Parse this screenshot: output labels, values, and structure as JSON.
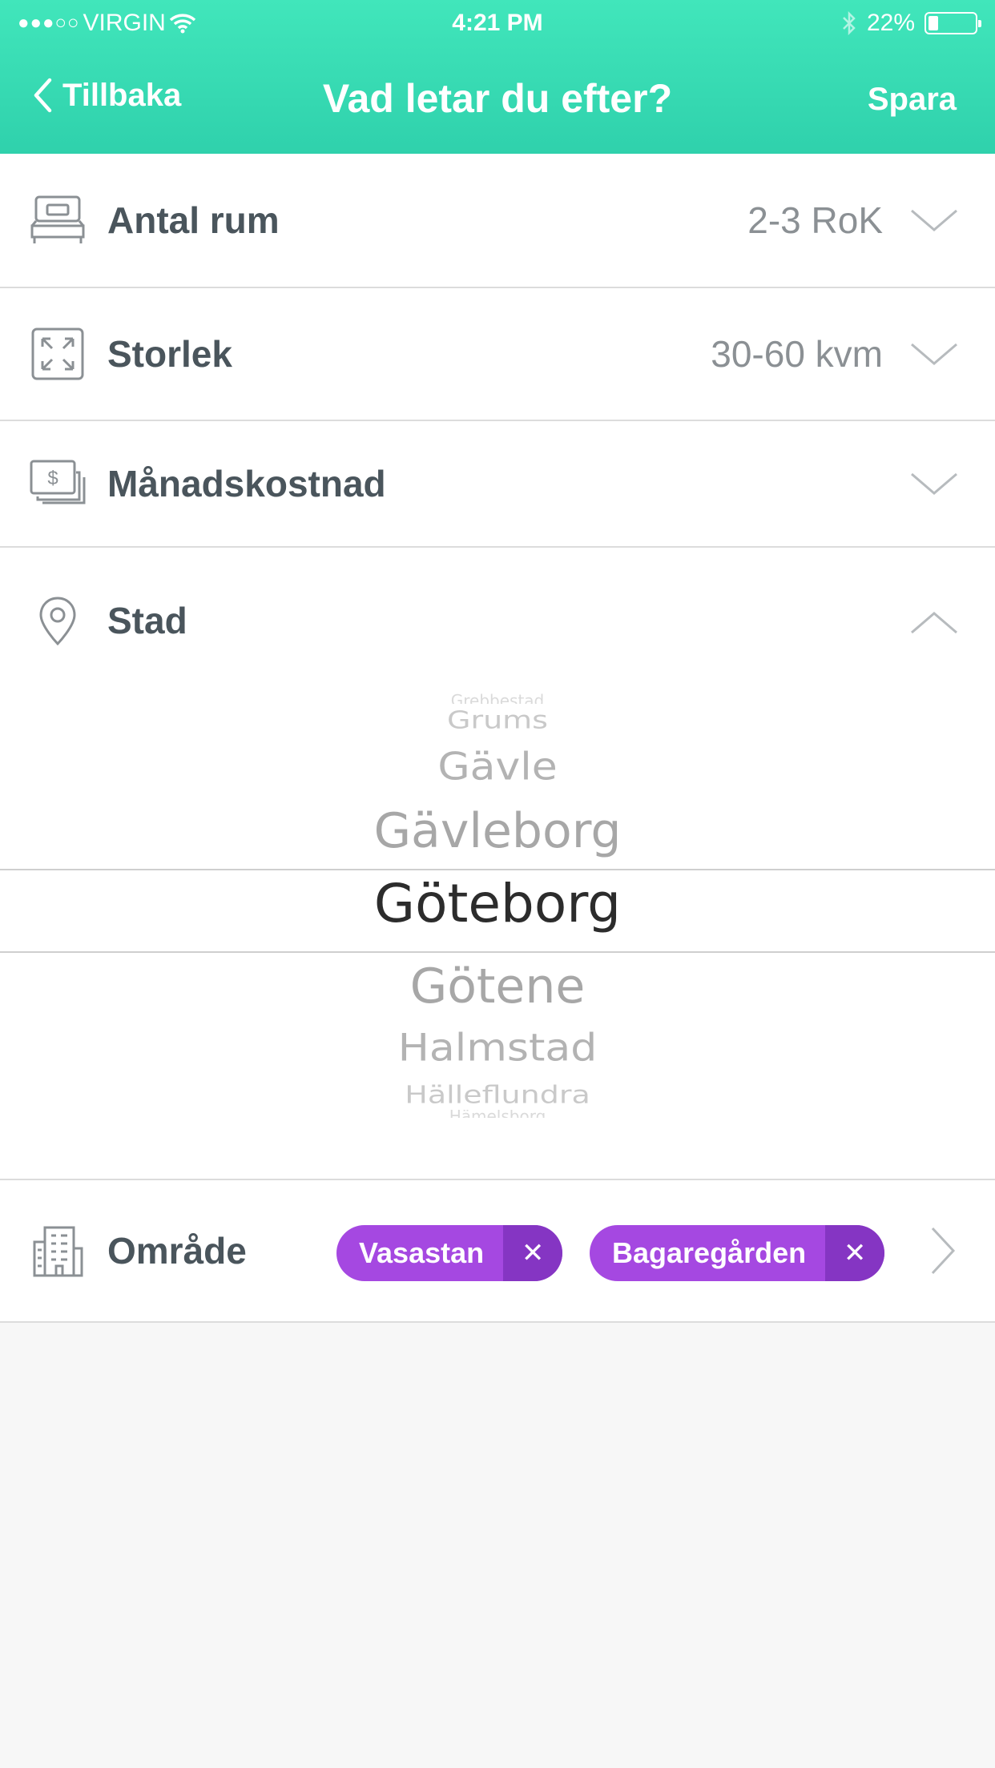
{
  "status": {
    "carrier": "VIRGIN",
    "time": "4:21 PM",
    "battery": "22%",
    "battery_level": 0.22
  },
  "nav": {
    "back_label": "Tillbaka",
    "title": "Vad letar du efter?",
    "save_label": "Spara"
  },
  "rows": {
    "rooms": {
      "label": "Antal rum",
      "value": "2-3 RoK",
      "icon": "bed-icon"
    },
    "size": {
      "label": "Storlek",
      "value": "30-60 kvm",
      "icon": "expand-icon"
    },
    "cost": {
      "label": "Månadskostnad",
      "value": "",
      "icon": "money-icon"
    },
    "city": {
      "label": "Stad",
      "icon": "location-pin-icon"
    },
    "area": {
      "label": "Område",
      "icon": "building-icon"
    }
  },
  "city_picker": {
    "options": [
      "Grebbestad",
      "Grums",
      "Gävle",
      "Gävleborg",
      "Göteborg",
      "Götene",
      "Halmstad",
      "Hälleflundra",
      "Hämelsborg"
    ],
    "selected": "Göteborg"
  },
  "area_tags": [
    {
      "label": "Vasastan",
      "remove": "✕"
    },
    {
      "label": "Bagaregården",
      "remove": "✕"
    }
  ],
  "colors": {
    "header": "#34d9b1",
    "tag": "#a548e1",
    "tag_remove": "#8535c3"
  }
}
